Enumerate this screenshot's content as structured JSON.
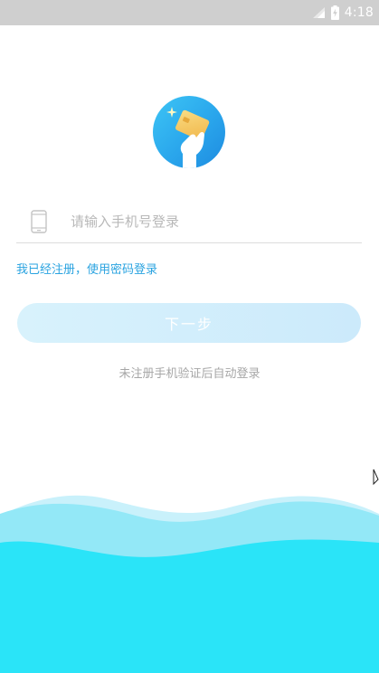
{
  "status_bar": {
    "time": "4:18",
    "icons": [
      "signal-icon",
      "battery-charging-icon"
    ]
  },
  "login": {
    "logo_icon": "card-in-hand-icon",
    "phone_icon": "phone-icon",
    "phone_value": "",
    "phone_placeholder": "请输入手机号登录",
    "password_login_link": "我已经注册，使用密码登录",
    "next_button": "下一步",
    "hint": "未注册手机验证后自动登录"
  },
  "colors": {
    "accent": "#2aa3e0",
    "logo_blue": "#2aa6ec",
    "button_bg": "#d8f2fc",
    "wave_light": "#c9f1fb",
    "wave_mid": "#93e8f7",
    "wave_deep": "#2ae4f8"
  }
}
